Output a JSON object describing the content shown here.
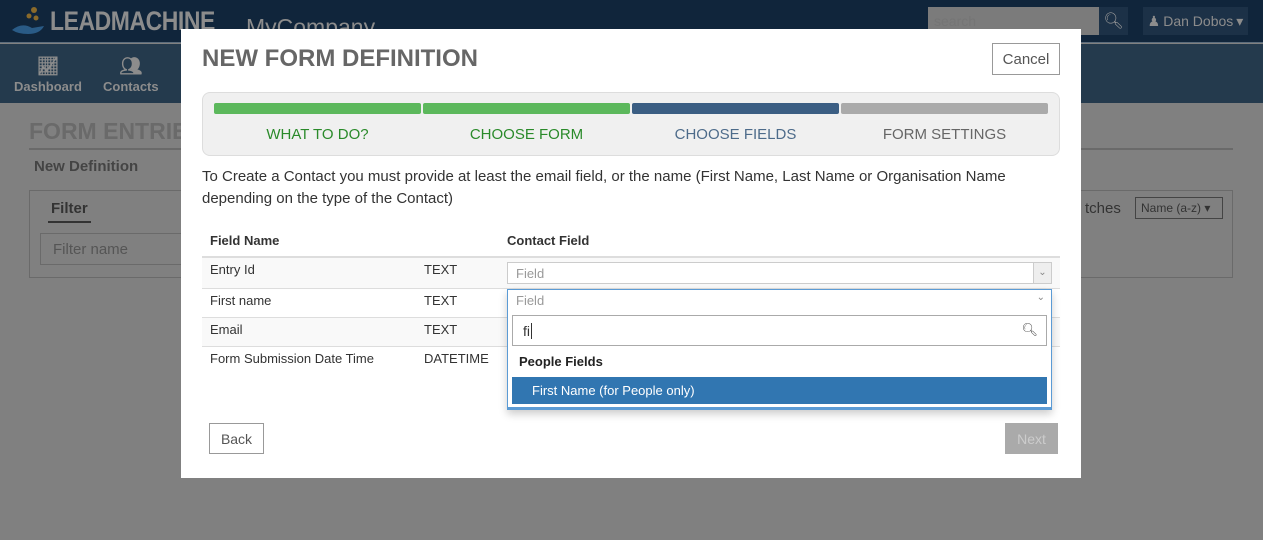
{
  "header": {
    "logo": "LEADMACHINE",
    "company": "MyCompany",
    "search_placeholder": "search",
    "user": "Dan Dobos"
  },
  "nav": [
    {
      "label": "Dashboard",
      "icon": "chart-line-icon"
    },
    {
      "label": "Contacts",
      "icon": "users-icon"
    }
  ],
  "background": {
    "title": "FORM ENTRIE",
    "subtitle": "New Definition",
    "filter_tab": "Filter",
    "filter_placeholder": "Filter name",
    "matches": "tches",
    "sort": "Name (a-z)"
  },
  "modal": {
    "title": "NEW FORM DEFINITION",
    "cancel": "Cancel",
    "steps": [
      {
        "label": "WHAT TO DO?",
        "state": "done",
        "color": "#5cb85c"
      },
      {
        "label": "CHOOSE FORM",
        "state": "done",
        "color": "#5cb85c"
      },
      {
        "label": "CHOOSE FIELDS",
        "state": "current",
        "color": "#3b5e83"
      },
      {
        "label": "FORM SETTINGS",
        "state": "todo",
        "color": "#aaaaaa"
      }
    ],
    "intro": "To Create a Contact you must provide at least the email field, or the name (First Name, Last Name or Organisation Name depending on the type of the Contact)",
    "table": {
      "headers": [
        "Field Name",
        "",
        "Contact Field"
      ],
      "rows": [
        {
          "name": "Entry Id",
          "type": "TEXT",
          "field": "Field"
        },
        {
          "name": "First name",
          "type": "TEXT",
          "field": "Field"
        },
        {
          "name": "Email",
          "type": "TEXT",
          "field": ""
        },
        {
          "name": "Form Submission Date Time",
          "type": "DATETIME",
          "field": ""
        }
      ]
    },
    "dropdown": {
      "placeholder": "Field",
      "search_value": "fi",
      "group": "People Fields",
      "option": "First Name (for People only)"
    },
    "back": "Back",
    "next": "Next"
  }
}
